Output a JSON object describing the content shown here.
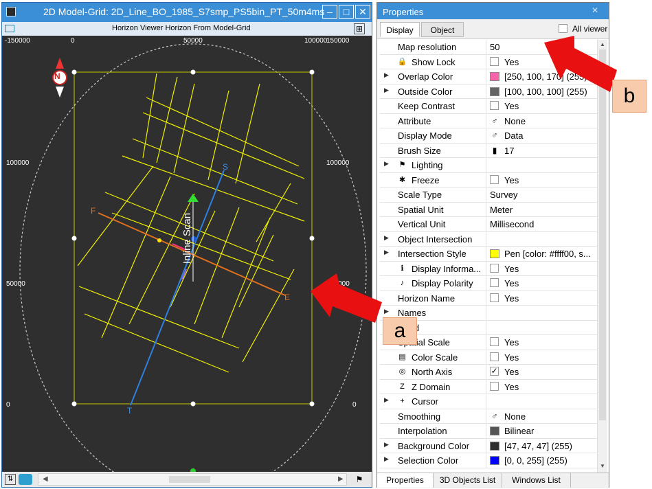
{
  "left_window": {
    "title": "2D Model-Grid: 2D_Line_BO_1985_S7smp_PS5bin_PT_50m4ms",
    "subtitle": "Horizon Viewer Horizon From Model-Grid",
    "controls": {
      "minimize": "–",
      "maximize": "□",
      "close": "✕"
    }
  },
  "viewer": {
    "top_ticks": [
      "-150000",
      "0",
      "50000",
      "100000",
      "150000"
    ],
    "left_ticks": [
      "100000",
      "50000",
      "0"
    ],
    "right_ticks": [
      "100000",
      "50000",
      "0"
    ],
    "north_label": "N",
    "line_labels": {
      "s": "S",
      "t": "T",
      "f": "F",
      "e": "E"
    },
    "scan_label": "Inline Scan",
    "colors": {
      "background": "#2f2f2f",
      "lines": "#f0f000",
      "st_line": "#2e7fe0",
      "fe_line": "#e0701e"
    }
  },
  "properties": {
    "title": "Properties",
    "tabs": [
      "Display",
      "Object"
    ],
    "all_viewers_label": "All viewer",
    "rows": [
      {
        "arrow": "",
        "name": "Map resolution",
        "icon": "",
        "kind": "text",
        "value": "50"
      },
      {
        "arrow": "",
        "name": "Show Lock",
        "icon": "lock-icon",
        "kind": "check",
        "checked": false,
        "value": "Yes"
      },
      {
        "arrow": "▶",
        "name": "Overlap Color",
        "icon": "",
        "kind": "swatch",
        "color": "#fa64aa",
        "value": "[250, 100, 170] (255)"
      },
      {
        "arrow": "▶",
        "name": "Outside Color",
        "icon": "",
        "kind": "swatch",
        "color": "#646464",
        "value": "[100, 100, 100] (255)"
      },
      {
        "arrow": "",
        "name": "Keep Contrast",
        "icon": "",
        "kind": "check",
        "checked": false,
        "value": "Yes"
      },
      {
        "arrow": "",
        "name": "Attribute",
        "icon": "",
        "kind": "iconval",
        "vicon": "♂",
        "value": "None"
      },
      {
        "arrow": "",
        "name": "Display Mode",
        "icon": "",
        "kind": "iconval",
        "vicon": "♂",
        "value": "Data"
      },
      {
        "arrow": "",
        "name": "Brush Size",
        "icon": "",
        "kind": "iconval",
        "vicon": "▮",
        "value": "17"
      },
      {
        "arrow": "▶",
        "name": "Lighting",
        "icon": "flag-icon",
        "kind": "none",
        "value": ""
      },
      {
        "arrow": "",
        "name": "Freeze",
        "icon": "snowflake-icon",
        "kind": "check",
        "checked": false,
        "value": "Yes"
      },
      {
        "arrow": "",
        "name": "Scale Type",
        "icon": "",
        "kind": "text",
        "value": "Survey"
      },
      {
        "arrow": "",
        "name": "Spatial Unit",
        "icon": "",
        "kind": "text",
        "value": "Meter"
      },
      {
        "arrow": "",
        "name": "Vertical Unit",
        "icon": "",
        "kind": "text",
        "value": "Millisecond"
      },
      {
        "arrow": "▶",
        "name": "Object Intersection",
        "icon": "",
        "kind": "none",
        "value": ""
      },
      {
        "arrow": "▶",
        "name": "Intersection Style",
        "icon": "",
        "kind": "swatch",
        "color": "#ffff00",
        "value": "Pen [color: #ffff00, s..."
      },
      {
        "arrow": "",
        "name": "Display Informa...",
        "icon": "info-icon",
        "kind": "check",
        "checked": false,
        "value": "Yes"
      },
      {
        "arrow": "",
        "name": "Display Polarity",
        "icon": "polarity-icon",
        "kind": "check",
        "checked": false,
        "value": "Yes"
      },
      {
        "arrow": "",
        "name": "Horizon Name",
        "icon": "",
        "kind": "check",
        "checked": false,
        "value": "Yes"
      },
      {
        "arrow": "▶",
        "name": "Names",
        "icon": "",
        "kind": "none",
        "value": ""
      },
      {
        "arrow": "",
        "name": "Head",
        "icon": "",
        "kind": "none",
        "value": ""
      },
      {
        "arrow": "",
        "name": "Spatial Scale",
        "icon": "",
        "kind": "check",
        "checked": false,
        "value": "Yes"
      },
      {
        "arrow": "",
        "name": "Color Scale",
        "icon": "colorscale-icon",
        "kind": "check",
        "checked": false,
        "value": "Yes"
      },
      {
        "arrow": "",
        "name": "North Axis",
        "icon": "compass-icon",
        "kind": "check",
        "checked": true,
        "value": "Yes"
      },
      {
        "arrow": "",
        "name": "Z Domain",
        "icon": "zdomain-icon",
        "kind": "check",
        "checked": false,
        "value": "Yes"
      },
      {
        "arrow": "▶",
        "name": "Cursor",
        "icon": "cursor-cross-icon",
        "kind": "none",
        "value": ""
      },
      {
        "arrow": "",
        "name": "Smoothing",
        "icon": "",
        "kind": "iconval",
        "vicon": "♂",
        "value": "None"
      },
      {
        "arrow": "",
        "name": "Interpolation",
        "icon": "",
        "kind": "swatch",
        "color": "#555555",
        "value": "Bilinear"
      },
      {
        "arrow": "▶",
        "name": "Background Color",
        "icon": "",
        "kind": "swatch",
        "color": "#2f2f2f",
        "value": "[47, 47, 47] (255)"
      },
      {
        "arrow": "▶",
        "name": "Selection Color",
        "icon": "",
        "kind": "swatch",
        "color": "#0000ff",
        "value": "[0, 0, 255] (255)"
      }
    ],
    "bottom_tabs": [
      "Properties",
      "3D Objects List",
      "Windows List"
    ]
  },
  "callouts": {
    "a": "a",
    "b": "b"
  }
}
